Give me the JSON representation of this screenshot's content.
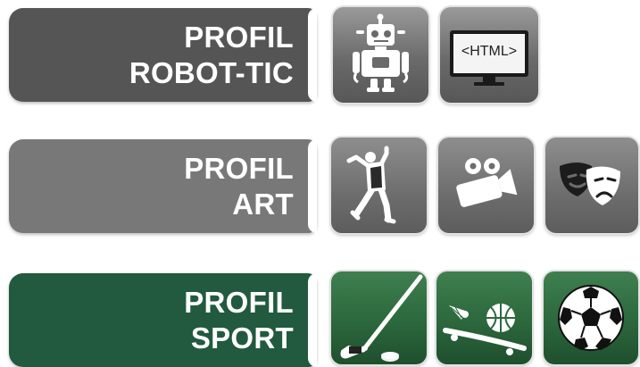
{
  "profiles": [
    {
      "line1": "PROFIL",
      "line2": "ROBOT-TIC",
      "color": "#555555",
      "tiles": [
        {
          "icon": "robot-icon"
        },
        {
          "icon": "html-monitor-icon",
          "label": "<HTML>"
        }
      ]
    },
    {
      "line1": "PROFIL",
      "line2": "ART",
      "color": "#787878",
      "tiles": [
        {
          "icon": "dancer-icon"
        },
        {
          "icon": "film-camera-icon"
        },
        {
          "icon": "theater-masks-icon"
        }
      ]
    },
    {
      "line1": "PROFIL",
      "line2": "SPORT",
      "color": "#215a3e",
      "tiles": [
        {
          "icon": "hockey-stick-icon"
        },
        {
          "icon": "badminton-basketball-skateboard-icon"
        },
        {
          "icon": "soccer-ball-icon"
        }
      ]
    }
  ]
}
